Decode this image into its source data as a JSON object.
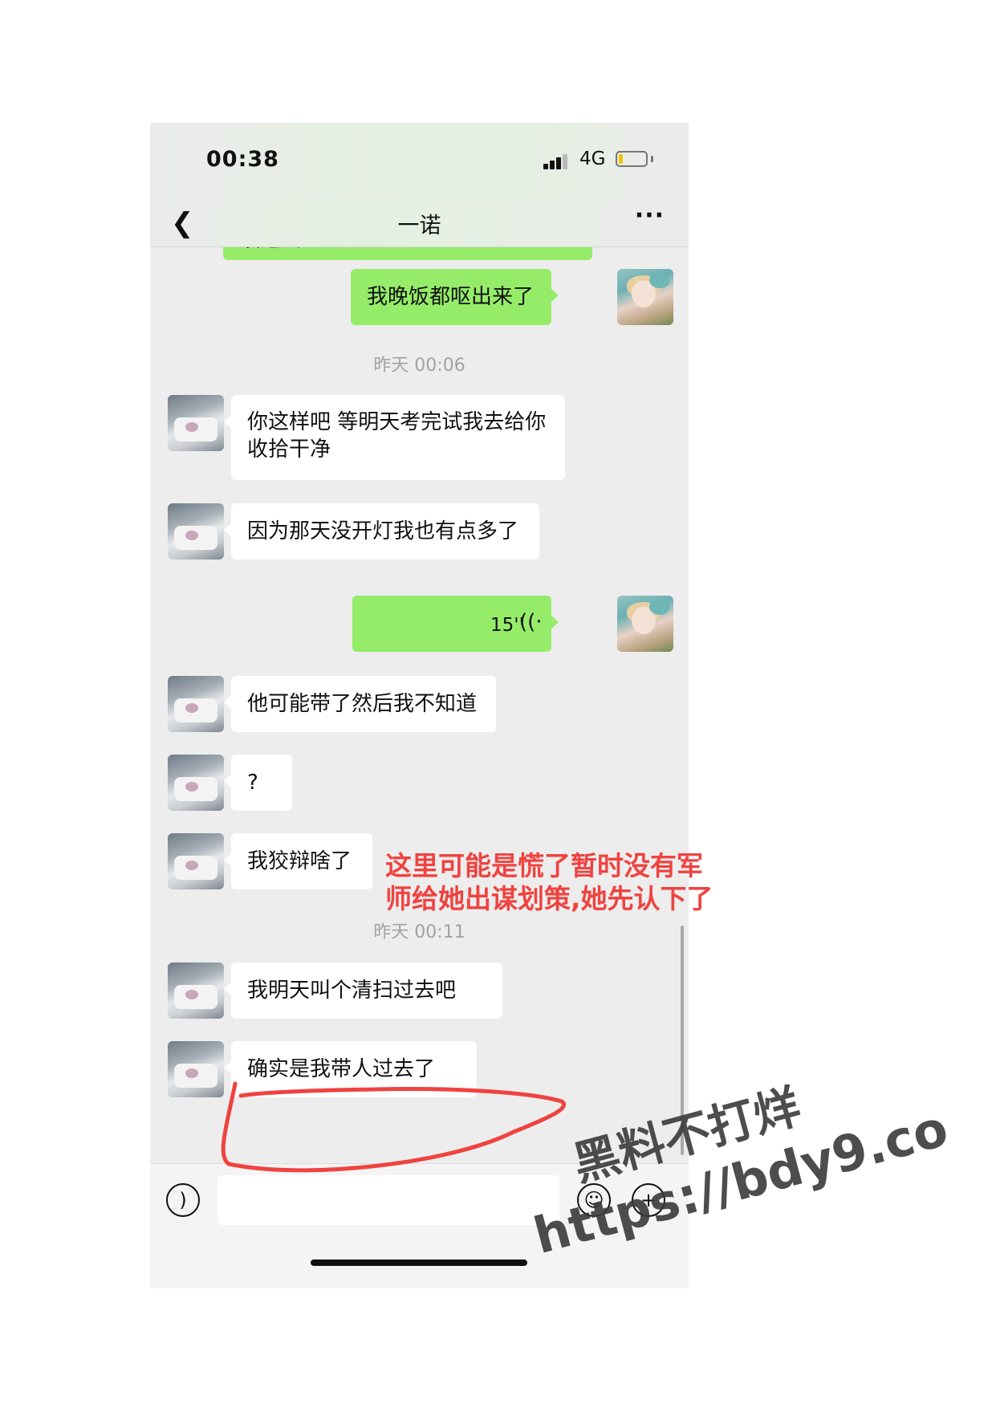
{
  "status_bar": {
    "time": "00:38",
    "network": "4G"
  },
  "nav": {
    "back_icon": "chevron-left-icon",
    "title": "一诺",
    "more_icon": "more-dots-icon"
  },
  "messages": [
    {
      "id": "m0",
      "side": "out",
      "text": "须过去"
    },
    {
      "id": "m1",
      "side": "out",
      "text": "我晚饭都呕出来了"
    },
    {
      "id": "t1",
      "type": "timestamp",
      "text": "昨天 00:06"
    },
    {
      "id": "m2",
      "side": "in",
      "text": "你这样吧 等明天考完试我去给你收拾干净"
    },
    {
      "id": "m3",
      "side": "in",
      "text": "因为那天没开灯我也有点多了"
    },
    {
      "id": "m4",
      "side": "out",
      "type": "voice",
      "duration": "15''"
    },
    {
      "id": "m5",
      "side": "in",
      "text": "他可能带了然后我不知道"
    },
    {
      "id": "m6",
      "side": "in",
      "text": "?"
    },
    {
      "id": "m7",
      "side": "in",
      "text": "我狡辩啥了"
    },
    {
      "id": "t2",
      "type": "timestamp",
      "text": "昨天 00:11"
    },
    {
      "id": "m8",
      "side": "in",
      "text": "我明天叫个清扫过去吧"
    },
    {
      "id": "m9",
      "side": "in",
      "text": "确实是我带人过去了"
    }
  ],
  "input_bar": {
    "voice_icon": "voice-input-icon",
    "emoji_icon": "emoji-icon",
    "plus_icon": "plus-icon"
  },
  "annotation": {
    "text": "这里可能是慌了暂时没有军师给她出谋划策,她先认下了",
    "color": "#ef4340"
  },
  "watermark": {
    "line1": "黑料不打烊",
    "line2": "https://bdy9.co"
  },
  "colors": {
    "outgoing_bubble": "#95ec69",
    "incoming_bubble": "#ffffff",
    "chat_background": "#ededed"
  }
}
